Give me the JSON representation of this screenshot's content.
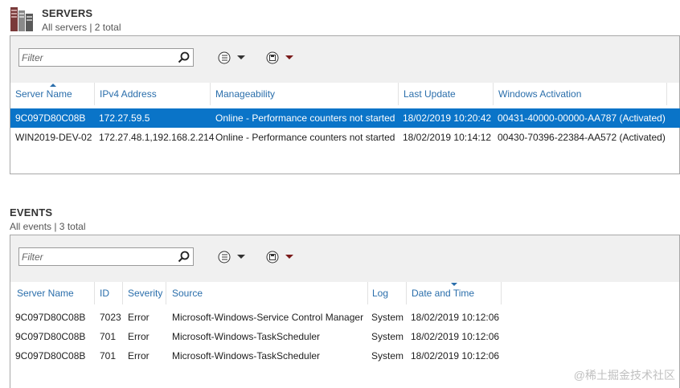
{
  "servers": {
    "title": "SERVERS",
    "subtitle": "All servers | 2 total",
    "filter_placeholder": "Filter",
    "columns": [
      "Server Name",
      "IPv4 Address",
      "Manageability",
      "Last Update",
      "Windows Activation"
    ],
    "rows": [
      [
        "9C097D80C08B",
        "172.27.59.5",
        "Online - Performance counters not started",
        "18/02/2019 10:20:42",
        "00431-40000-00000-AA787 (Activated)"
      ],
      [
        "WIN2019-DEV-02",
        "172.27.48.1,192.168.2.214",
        "Online - Performance counters not started",
        "18/02/2019 10:14:12",
        "00430-70396-22384-AA572 (Activated)"
      ]
    ],
    "selected_row": 0
  },
  "events": {
    "title": "EVENTS",
    "subtitle": "All events | 3 total",
    "filter_placeholder": "Filter",
    "columns": [
      "Server Name",
      "ID",
      "Severity",
      "Source",
      "Log",
      "Date and Time"
    ],
    "rows": [
      [
        "9C097D80C08B",
        "7023",
        "Error",
        "Microsoft-Windows-Service Control Manager",
        "System",
        "18/02/2019 10:12:06"
      ],
      [
        "9C097D80C08B",
        "701",
        "Error",
        "Microsoft-Windows-TaskScheduler",
        "System",
        "18/02/2019 10:12:06"
      ],
      [
        "9C097D80C08B",
        "701",
        "Error",
        "Microsoft-Windows-TaskScheduler",
        "System",
        "18/02/2019 10:12:06"
      ]
    ]
  },
  "watermark": "@稀土掘金技术社区",
  "colors": {
    "accent": "#0a74c8",
    "header_text": "#2a6eab",
    "toolbar_bg": "#f0f0f0"
  }
}
